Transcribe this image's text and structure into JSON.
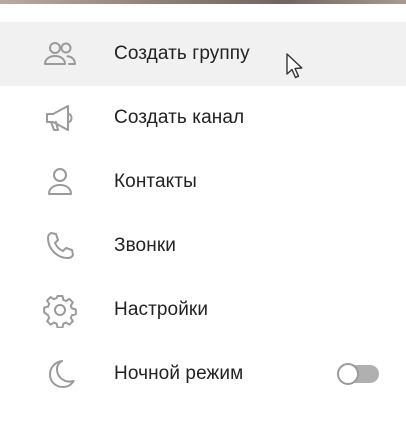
{
  "colors": {
    "icon_stroke": "#9a9a9a",
    "label_text": "#222222",
    "hover_bg": "#f1f1f1",
    "toggle_off": "#b0b0b0"
  },
  "menu": {
    "items": [
      {
        "label": "Создать группу",
        "icon": "group-icon"
      },
      {
        "label": "Создать канал",
        "icon": "megaphone-icon"
      },
      {
        "label": "Контакты",
        "icon": "person-icon"
      },
      {
        "label": "Звонки",
        "icon": "phone-icon"
      },
      {
        "label": "Настройки",
        "icon": "gear-icon"
      },
      {
        "label": "Ночной режим",
        "icon": "moon-icon",
        "toggle": false
      }
    ]
  }
}
